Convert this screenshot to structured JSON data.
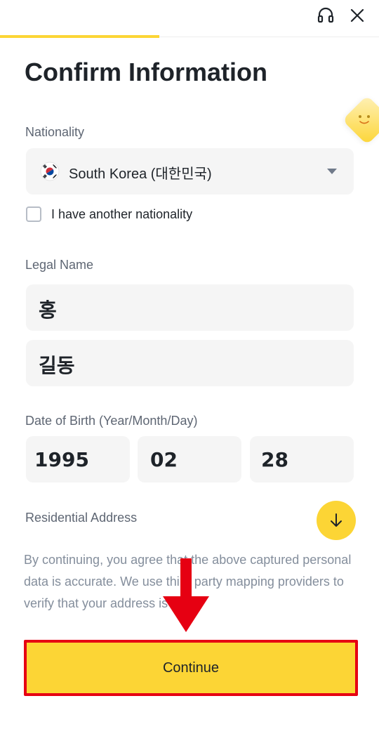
{
  "header": {
    "support_icon": "headset-icon",
    "close_icon": "close-icon",
    "progress_percent": 42
  },
  "title": "Confirm Information",
  "nationality": {
    "label": "Nationality",
    "selected_value": "South Korea (대한민국)",
    "flag_icon": "south-korea-flag-icon",
    "another_nationality_label": "I have another nationality",
    "another_nationality_checked": false
  },
  "legal_name": {
    "label": "Legal Name",
    "last_name": "홍",
    "first_name": "길동"
  },
  "date_of_birth": {
    "label": "Date of Birth (Year/Month/Day)",
    "year": "1995",
    "month": "02",
    "day": "28"
  },
  "residential_address": {
    "label": "Residential Address",
    "expand_icon": "arrow-down-icon"
  },
  "disclaimer": "By continuing, you agree that the above captured personal data is accurate. We use third party mapping providers to verify that your address is valid.",
  "continue_button": {
    "label": "Continue"
  },
  "colors": {
    "accent": "#fcd535",
    "highlight_red": "#e60012",
    "field_bg": "#f5f5f5",
    "text_primary": "#1e2329",
    "text_secondary": "#5e6673",
    "text_muted": "#848e9c"
  }
}
